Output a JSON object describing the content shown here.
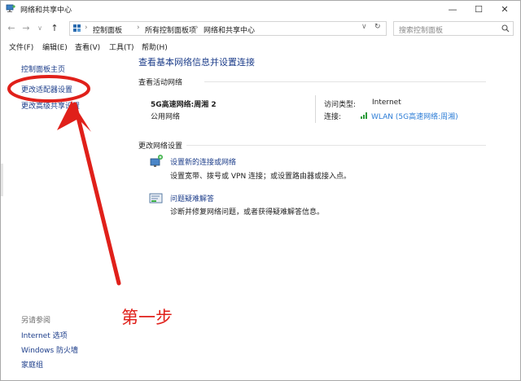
{
  "window": {
    "title": "网络和共享中心",
    "controls": {
      "minimize": "—",
      "maximize": "☐",
      "close": "✕"
    }
  },
  "address": {
    "back": "←",
    "forward": "→",
    "dropdown": "∨",
    "up": "↑",
    "crumbs": [
      "控制面板",
      "所有控制面板项",
      "网络和共享中心"
    ],
    "refresh": "↻",
    "search_placeholder": "搜索控制面板"
  },
  "menu": [
    "文件(F)",
    "编辑(E)",
    "查看(V)",
    "工具(T)",
    "帮助(H)"
  ],
  "sidebar": {
    "links": [
      "控制面板主页",
      "更改适配器设置",
      "更改高级共享设置"
    ],
    "see_also_title": "另请参阅",
    "see_also": [
      "Internet 选项",
      "Windows 防火墙",
      "家庭组"
    ]
  },
  "main": {
    "title": "查看基本网络信息并设置连接",
    "active_title": "查看活动网络",
    "network_name": "5G高速网络:周湘  2",
    "network_type": "公用网络",
    "access_type_label": "访问类型:",
    "access_type_value": "Internet",
    "connection_label": "连接:",
    "connection_value": "WLAN (5G高速网络:周湘)",
    "change_title": "更改网络设置",
    "tasks": [
      {
        "title": "设置新的连接或网络",
        "desc": "设置宽带、拨号或 VPN 连接；或设置路由器或接入点。"
      },
      {
        "title": "问题疑难解答",
        "desc": "诊断并修复网络问题，或者获得疑难解答信息。"
      }
    ]
  },
  "annotation": {
    "step_text": "第一步",
    "color": "#e0201a"
  },
  "colors": {
    "link": "#1c3d8a",
    "wlan": "#2a7bd6",
    "annotation": "#e0201a"
  }
}
